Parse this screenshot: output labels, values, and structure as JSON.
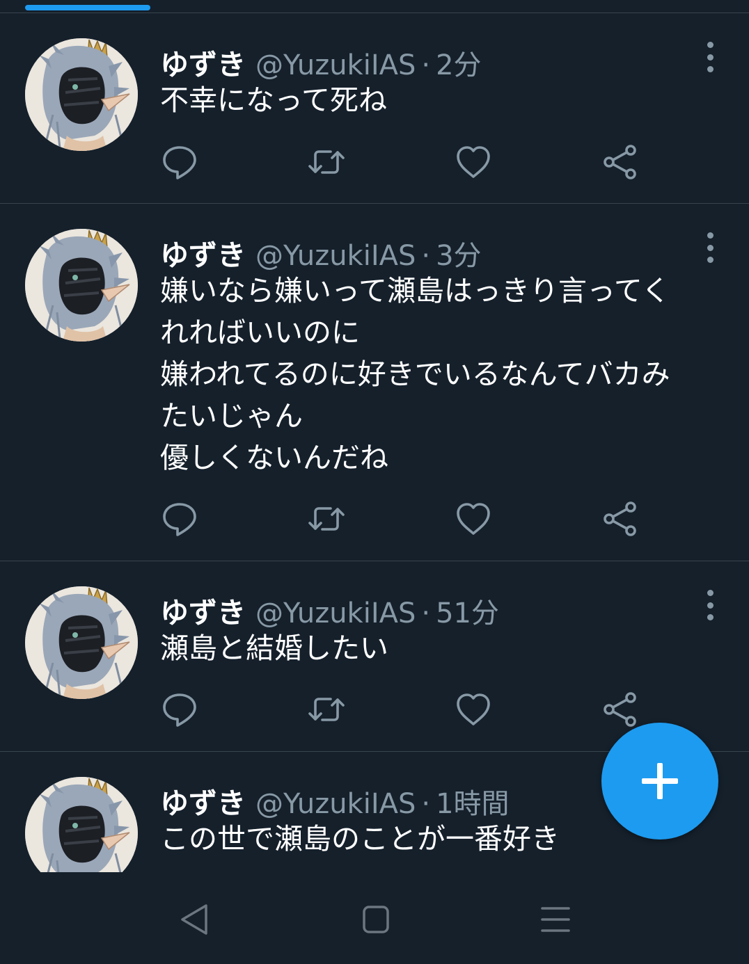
{
  "tweets": [
    {
      "name": "ゆずき",
      "handle": "@YuzukiIAS",
      "sep": "·",
      "time": "2分",
      "lines": [
        "不幸になって死ね"
      ]
    },
    {
      "name": "ゆずき",
      "handle": "@YuzukiIAS",
      "sep": "·",
      "time": "3分",
      "lines": [
        "嫌いなら嫌いって瀬島はっきり言ってく",
        "れればいいのに",
        "嫌われてるのに好きでいるなんてバカみ",
        "たいじゃん",
        "優しくないんだね"
      ]
    },
    {
      "name": "ゆずき",
      "handle": "@YuzukiIAS",
      "sep": "·",
      "time": "51分",
      "lines": [
        "瀬島と結婚したい"
      ]
    },
    {
      "name": "ゆずき",
      "handle": "@YuzukiIAS",
      "sep": "·",
      "time": "1時間",
      "lines": [
        "この世で瀬島のことが一番好き"
      ]
    }
  ],
  "icons": {
    "reply": "reply-icon",
    "retweet": "retweet-icon",
    "like": "like-icon",
    "share": "share-icon",
    "more": "more-options-icon",
    "compose": "compose-plus-icon",
    "nav_back": "nav-back-icon",
    "nav_home": "nav-home-icon",
    "nav_recents": "nav-recents-icon"
  },
  "colors": {
    "background": "#15202b",
    "divider": "#38444d",
    "text_primary": "#ffffff",
    "text_secondary": "#8899a6",
    "accent": "#1d9bf0"
  }
}
